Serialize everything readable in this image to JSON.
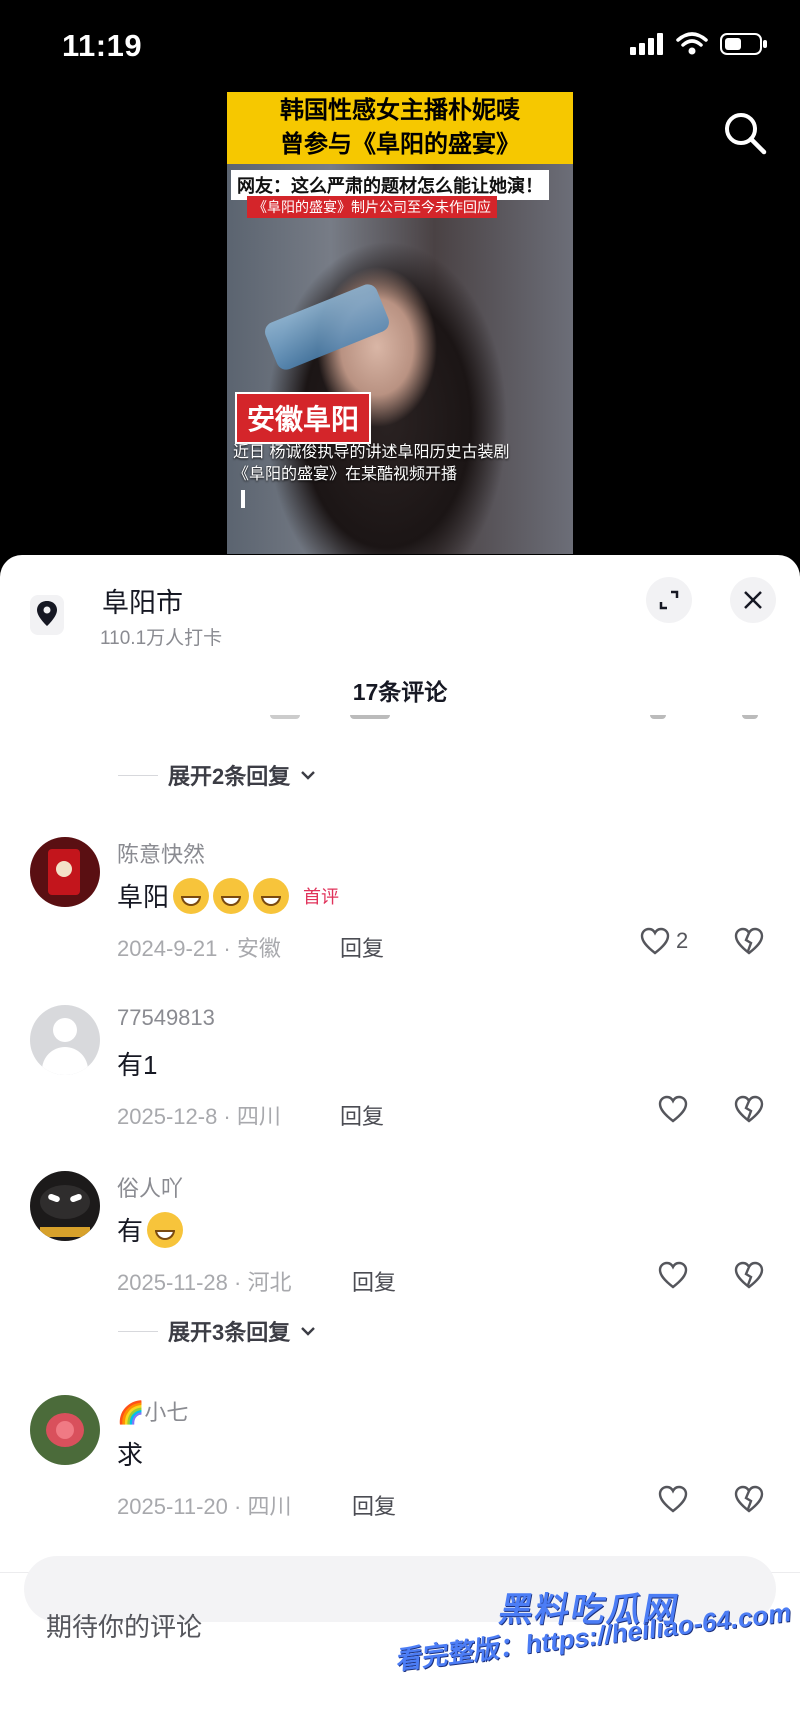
{
  "status": {
    "time": "11:19"
  },
  "video": {
    "headline_line1": "韩国性感女主播朴妮唛",
    "headline_line2": "曾参与《阜阳的盛宴》",
    "subtitle1": "网友：这么严肃的题材怎么能让她演！",
    "subtitle2": "《阜阳的盛宴》制片公司至今未作回应",
    "place_tag": "安徽阜阳",
    "caption_line1": "近日 杨诚俊执导的讲述阜阳历史古装剧",
    "caption_line2": "《阜阳的盛宴》在某酷视频开播"
  },
  "location": {
    "name": "阜阳市",
    "checkins": "110.1万人打卡"
  },
  "comments_title": "17条评论",
  "expand_replies_1": "展开2条回复",
  "expand_replies_2": "展开3条回复",
  "comments": [
    {
      "user": "陈意快然",
      "text": "阜阳",
      "emoji_count": 3,
      "badge": "首评",
      "date_loc": "2024-9-21 · 安徽",
      "reply": "回复",
      "likes": "2"
    },
    {
      "user": "77549813",
      "text": "有1",
      "date_loc": "2025-12-8 · 四川",
      "reply": "回复",
      "likes": ""
    },
    {
      "user": "俗人吖",
      "text": "有",
      "date_loc": "2025-11-28 · 河北",
      "reply": "回复",
      "likes": ""
    },
    {
      "user": "🌈小七",
      "text": "求",
      "date_loc": "2025-11-20 · 四川",
      "reply": "回复",
      "likes": ""
    }
  ],
  "input": {
    "placeholder": "期待你的评论"
  },
  "watermark": {
    "brand": "黑料吃瓜网",
    "url": "看完整版：https://heiliao-64.com"
  },
  "colors": {
    "accent": "#e0325a",
    "watermark": "#4c7df5"
  }
}
